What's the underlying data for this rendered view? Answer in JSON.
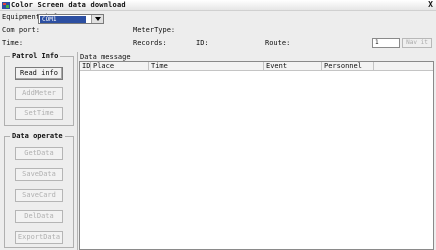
{
  "window": {
    "title": "Color Screen data download",
    "close_label": "X"
  },
  "equipment": {
    "group_label": "Equipment info",
    "com_port_label": "Com port:",
    "com_port_value": "COM1",
    "meter_type_label": "MeterType:",
    "meter_type_value": "",
    "time_label": "Time:",
    "records_label": "Records:",
    "id_label": "ID:",
    "route_label": "Route:",
    "route_value": "1",
    "route_button_label": "Nav it"
  },
  "patrol_info": {
    "title": "Patrol Info",
    "buttons": [
      {
        "label": "Read info",
        "enabled": true
      },
      {
        "label": "AddMeter",
        "enabled": false
      },
      {
        "label": "SetTime",
        "enabled": false
      }
    ]
  },
  "data_operate": {
    "title": "Data operate",
    "buttons": [
      {
        "label": "GetData",
        "enabled": false
      },
      {
        "label": "SaveData",
        "enabled": false
      },
      {
        "label": "SaveCard",
        "enabled": false
      },
      {
        "label": "DelData",
        "enabled": false
      },
      {
        "label": "ExportData",
        "enabled": false
      }
    ]
  },
  "data_message": {
    "label": "Data message",
    "columns": [
      "ID",
      "Place",
      "Time",
      "Event",
      "Personnel"
    ],
    "rows": []
  },
  "colors": {
    "selection": "#2c4fa2",
    "window_bg": "#ededed",
    "disabled_text": "#b0b0b0"
  }
}
